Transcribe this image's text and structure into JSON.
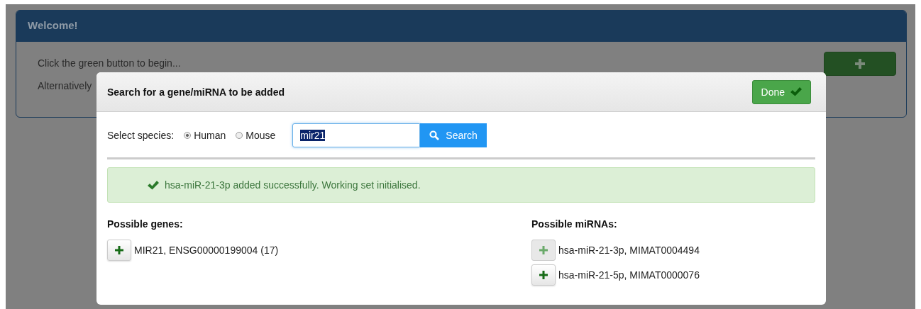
{
  "welcome_panel": {
    "title": "Welcome!",
    "lines": [
      "Click the green button to begin...",
      "Alternatively"
    ]
  },
  "dialog": {
    "title": "Search for a gene/miRNA to be added",
    "done_button": "Done",
    "species_label": "Select species:",
    "species": [
      {
        "label": "Human",
        "selected": true
      },
      {
        "label": "Mouse",
        "selected": false
      }
    ],
    "search": {
      "value": "mir21",
      "button": "Search"
    },
    "alert": {
      "message": "hsa-miR-21-3p added successfully. Working set initialised."
    },
    "genes": {
      "heading": "Possible genes:",
      "items": [
        {
          "label": "MIR21, ENSG00000199004 (17)",
          "disabled": false
        }
      ]
    },
    "mirnas": {
      "heading": "Possible miRNAs:",
      "items": [
        {
          "label": "hsa-miR-21-3p, MIMAT0004494",
          "disabled": true
        },
        {
          "label": "hsa-miR-21-5p, MIMAT0000076",
          "disabled": false
        }
      ]
    }
  }
}
